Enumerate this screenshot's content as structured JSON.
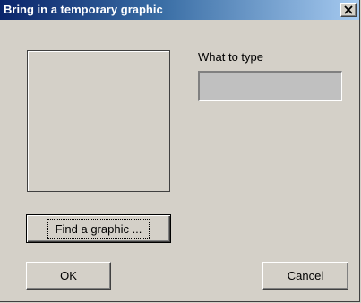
{
  "window": {
    "title": "Bring in a temporary graphic"
  },
  "icons": {
    "close": "close-icon"
  },
  "form": {
    "prompt_label": "What to type",
    "input_value": "",
    "input_placeholder": ""
  },
  "buttons": {
    "find_graphic": "Find a graphic ...",
    "ok": "OK",
    "cancel": "Cancel"
  },
  "colors": {
    "dialog_background": "#d4d0c8",
    "titlebar_start": "#0a246a",
    "titlebar_end": "#a6caf0",
    "input_background": "#c0c0c0"
  }
}
